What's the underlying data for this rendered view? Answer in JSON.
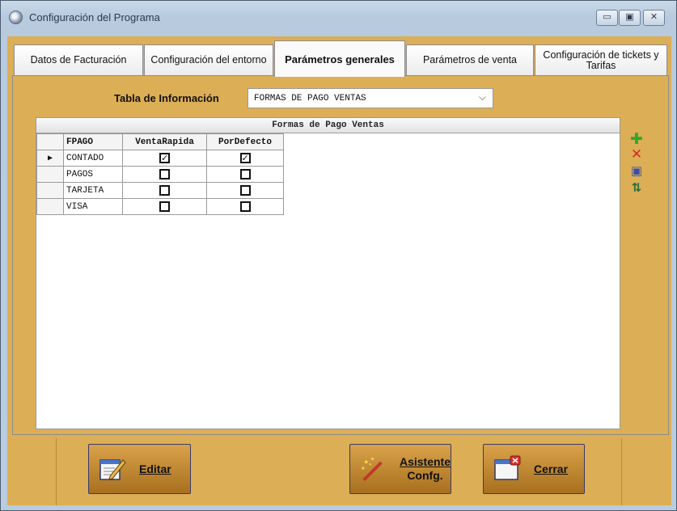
{
  "window": {
    "title": "Configuración del Programa",
    "controls": {
      "minimize": "▭",
      "maximize": "▣",
      "close": "✕"
    }
  },
  "tabs": [
    {
      "label": "Datos de Facturación",
      "active": false
    },
    {
      "label": "Configuración del entorno",
      "active": false
    },
    {
      "label": "Parámetros generales",
      "active": true
    },
    {
      "label": "Parámetros de venta",
      "active": false
    },
    {
      "label": "Configuración de tickets y Tarifas",
      "active": false
    }
  ],
  "info": {
    "label": "Tabla de Información",
    "selected": "FORMAS DE PAGO VENTAS"
  },
  "grid": {
    "caption": "Formas de Pago Ventas",
    "columns": [
      "FPAGO",
      "VentaRapida",
      "PorDefecto"
    ],
    "rows": [
      {
        "fpago": "CONTADO",
        "venta_rapida": true,
        "por_defecto": true,
        "current": true
      },
      {
        "fpago": "PAGOS",
        "venta_rapida": false,
        "por_defecto": false,
        "current": false
      },
      {
        "fpago": "TARJETA",
        "venta_rapida": false,
        "por_defecto": false,
        "current": false
      },
      {
        "fpago": "VISA",
        "venta_rapida": false,
        "por_defecto": false,
        "current": false
      }
    ],
    "row_indicator": "▶"
  },
  "side_toolbar": {
    "add": {
      "icon": "plus-icon",
      "glyph": "✚",
      "color": "#2fa82f"
    },
    "delete": {
      "icon": "delete-x-icon",
      "glyph": "✕",
      "color": "#d42a2a"
    },
    "save": {
      "icon": "floppy-disk-icon",
      "glyph": "▣",
      "color": "#3b4fa8"
    },
    "sort": {
      "icon": "sort-icon",
      "glyph": "⇅",
      "color": "#2b6f3a"
    }
  },
  "buttons": {
    "edit": {
      "label": "Editar",
      "icon": "edit-pencil-icon"
    },
    "wizard": {
      "line1": "Asistente",
      "line2": "Confg.",
      "icon": "magic-wand-icon"
    },
    "close": {
      "label": "Cerrar",
      "icon": "window-close-icon"
    }
  },
  "colors": {
    "panel_bg": "#dcae55",
    "button_bg": "#c48a33"
  }
}
